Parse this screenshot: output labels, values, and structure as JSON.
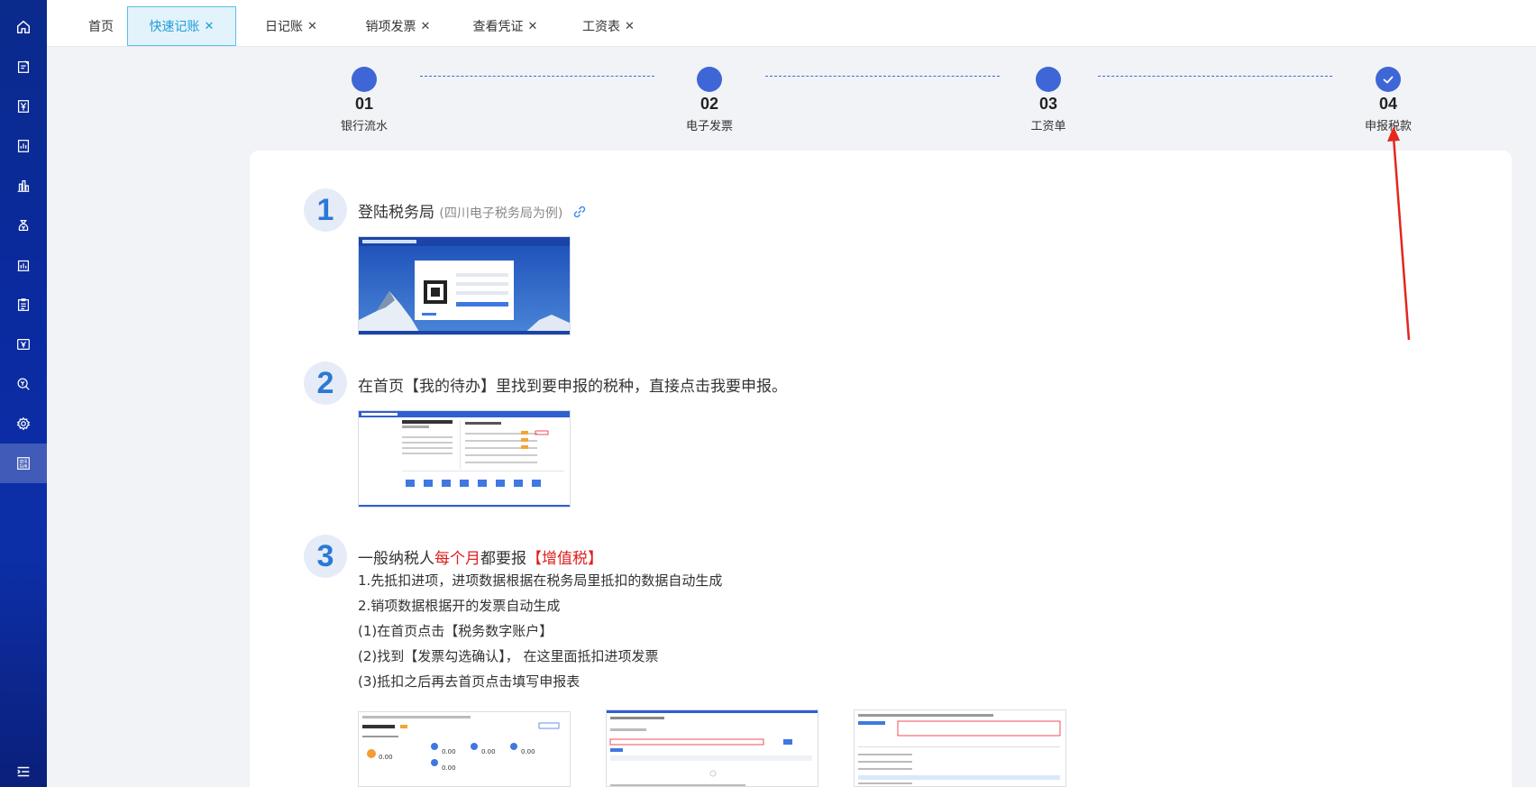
{
  "sidebar": {
    "items": [
      {
        "icon": "home-icon"
      },
      {
        "icon": "edit-document-icon"
      },
      {
        "icon": "yen-document-icon"
      },
      {
        "icon": "report-chart-icon"
      },
      {
        "icon": "bar-chart-icon"
      },
      {
        "icon": "money-bag-icon"
      },
      {
        "icon": "building-chart-icon"
      },
      {
        "icon": "clipboard-list-icon"
      },
      {
        "icon": "yen-card-icon"
      },
      {
        "icon": "search-money-icon"
      },
      {
        "icon": "settings-gear-icon"
      },
      {
        "icon": "user-guide-icon",
        "label": "使用指南"
      }
    ],
    "menu_icon": "collapse-menu-icon"
  },
  "tabs": [
    {
      "label": "首页",
      "closable": false
    },
    {
      "label": "快速记账",
      "closable": true,
      "active": true
    },
    {
      "label": "日记账",
      "closable": true
    },
    {
      "label": "销项发票",
      "closable": true
    },
    {
      "label": "查看凭证",
      "closable": true
    },
    {
      "label": "工资表",
      "closable": true
    }
  ],
  "steps": [
    {
      "num": "01",
      "label": "银行流水"
    },
    {
      "num": "02",
      "label": "电子发票"
    },
    {
      "num": "03",
      "label": "工资单"
    },
    {
      "num": "04",
      "label": "申报税款",
      "checked": true
    }
  ],
  "section1": {
    "num": "1",
    "title": "登陆税务局",
    "subtitle": "(四川电子税务局为例)"
  },
  "section2": {
    "num": "2",
    "title": "在首页【我的待办】里找到要申报的税种，直接点击我要申报。"
  },
  "section3": {
    "num": "3",
    "title_a": "一般纳税人",
    "title_b": "每个月",
    "title_c": "都要报",
    "title_d": "【增值税】",
    "lines": [
      "1.先抵扣进项，进项数据根据在税务局里抵扣的数据自动生成",
      "2.销项数据根据开的发票自动生成",
      "(1)在首页点击【税务数字账户】",
      "(2)找到【发票勾选确认】， 在这里面抵扣进项发票",
      "(3)抵扣之后再去首页点击填写申报表"
    ],
    "thumb_values": [
      "0.00",
      "0.00",
      "0.00",
      "0.00",
      "0.00"
    ]
  },
  "colors": {
    "accent": "#3f66d6",
    "tab_active": "#1c9dd8",
    "red": "#e01e1e",
    "badge_text": "#2b79d6"
  }
}
